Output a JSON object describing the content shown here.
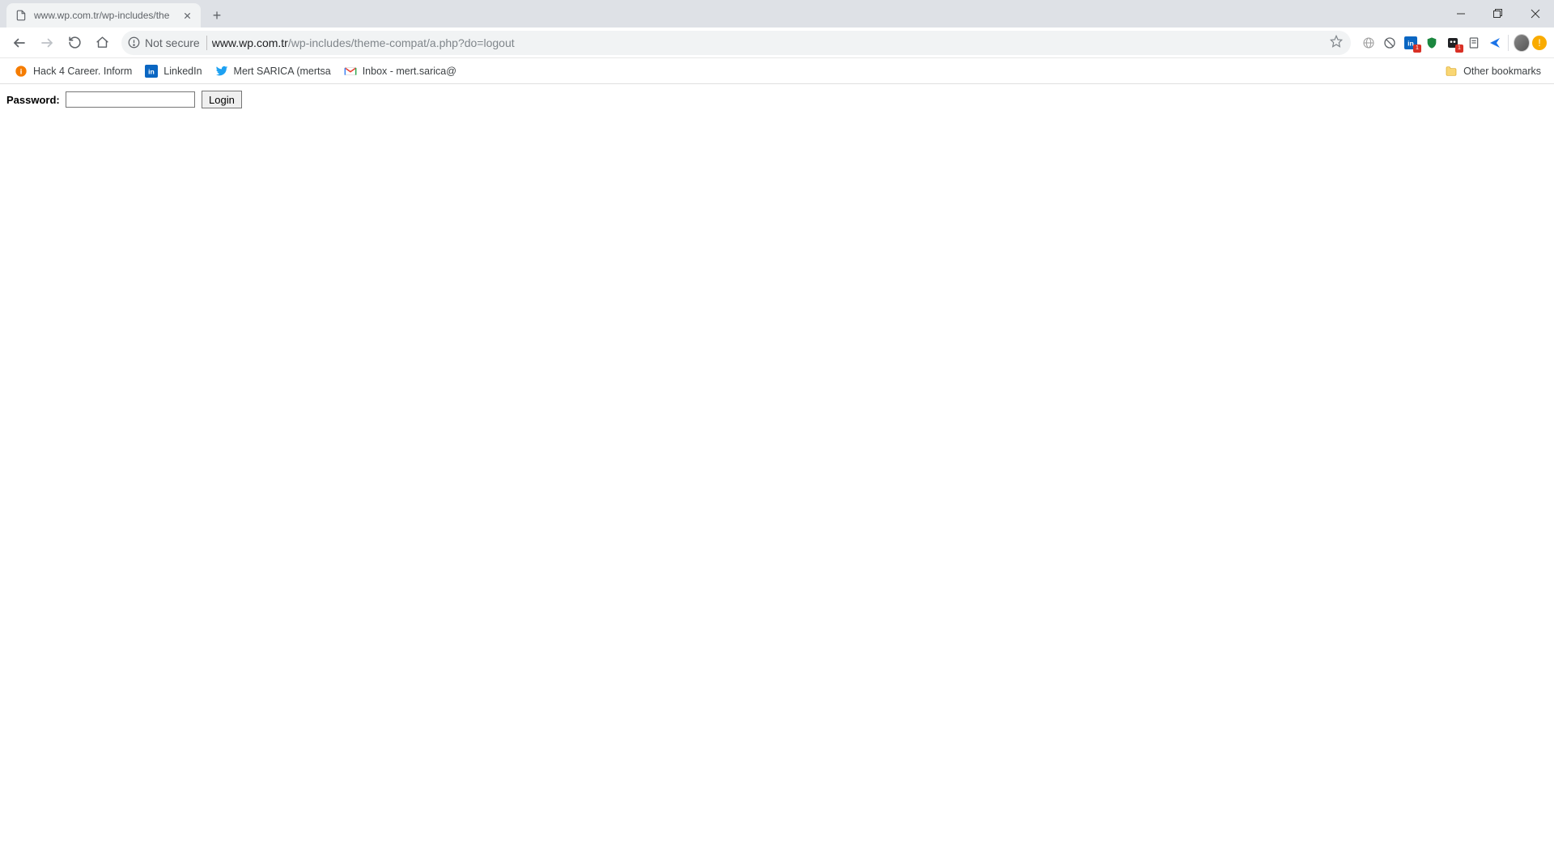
{
  "tab": {
    "title": "www.wp.com.tr/wp-includes/the"
  },
  "omnibox": {
    "security_label": "Not secure",
    "host": "www.wp.com.tr",
    "path": "/wp-includes/theme-compat/a.php?do=logout"
  },
  "bookmarks": {
    "items": [
      {
        "label": "Hack 4 Career. Inform",
        "icon": "orange-circle"
      },
      {
        "label": "LinkedIn",
        "icon": "linkedin"
      },
      {
        "label": "Mert SARICA (mertsa",
        "icon": "twitter"
      },
      {
        "label": "Inbox - mert.sarica@",
        "icon": "gmail"
      }
    ],
    "other_label": "Other bookmarks"
  },
  "extensions": [
    {
      "name": "idm",
      "color": "#9e9e9e",
      "shape": "globe"
    },
    {
      "name": "block",
      "color": "#5f6368",
      "shape": "noentry"
    },
    {
      "name": "linkedin",
      "color": "#0a66c2",
      "shape": "linkedin",
      "badge": "1"
    },
    {
      "name": "shield",
      "color": "#1b873f",
      "shape": "shield"
    },
    {
      "name": "dark",
      "color": "#202124",
      "shape": "square",
      "badge": "1"
    },
    {
      "name": "save",
      "color": "#5f6368",
      "shape": "page"
    },
    {
      "name": "send",
      "color": "#1a73e8",
      "shape": "rarrow"
    }
  ],
  "content": {
    "password_label": "Password:",
    "login_button": "Login",
    "password_value": ""
  }
}
